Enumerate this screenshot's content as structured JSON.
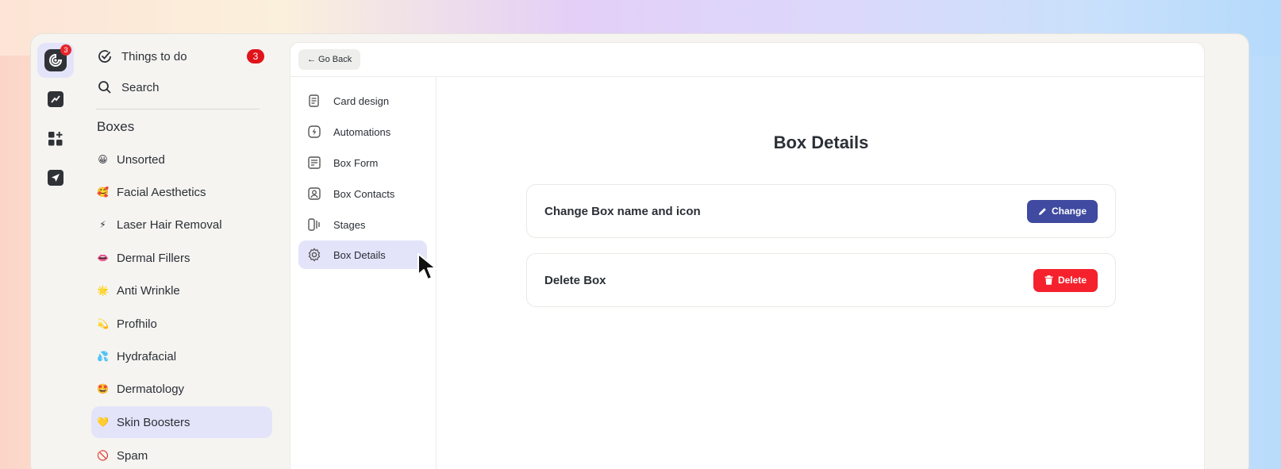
{
  "rail": {
    "logo_badge": "3",
    "icons": [
      "app-logo-icon",
      "chart-line-icon",
      "widgets-icon",
      "send-icon"
    ]
  },
  "sidebar": {
    "things_to_do": {
      "label": "Things to do",
      "count": "3",
      "icon": "check-circle-icon"
    },
    "search": {
      "label": "Search",
      "icon": "search-icon"
    },
    "boxes_title": "Boxes",
    "boxes": [
      {
        "emoji": "😀",
        "label": "Unsorted"
      },
      {
        "emoji": "🥰",
        "label": "Facial Aesthetics"
      },
      {
        "emoji": "⚡",
        "label": "Laser Hair Removal"
      },
      {
        "emoji": "👄",
        "label": "Dermal Fillers"
      },
      {
        "emoji": "🌟",
        "label": "Anti Wrinkle"
      },
      {
        "emoji": "💫",
        "label": "Profhilo"
      },
      {
        "emoji": "💦",
        "label": "Hydrafacial"
      },
      {
        "emoji": "🤩",
        "label": "Dermatology"
      },
      {
        "emoji": "💛",
        "label": "Skin Boosters",
        "active": true
      },
      {
        "emoji": "🚫",
        "label": "Spam"
      }
    ]
  },
  "topbar": {
    "go_back_label": "← Go Back"
  },
  "settings_nav": [
    {
      "label": "Card design",
      "icon": "card-design-icon"
    },
    {
      "label": "Automations",
      "icon": "automation-bolt-icon"
    },
    {
      "label": "Box Form",
      "icon": "form-icon"
    },
    {
      "label": "Box Contacts",
      "icon": "contacts-icon"
    },
    {
      "label": "Stages",
      "icon": "stages-icon"
    },
    {
      "label": "Box Details",
      "icon": "gear-icon",
      "active": true
    }
  ],
  "main": {
    "title": "Box Details",
    "change_card": {
      "label": "Change Box name and icon",
      "button": "Change",
      "button_icon": "pencil-icon"
    },
    "delete_card": {
      "label": "Delete Box",
      "button": "Delete",
      "button_icon": "trash-icon"
    }
  },
  "colors": {
    "accent": "#3f4aa0",
    "danger": "#f5222d",
    "active_bg": "#e3e4f9",
    "badge": "#e0141b"
  }
}
